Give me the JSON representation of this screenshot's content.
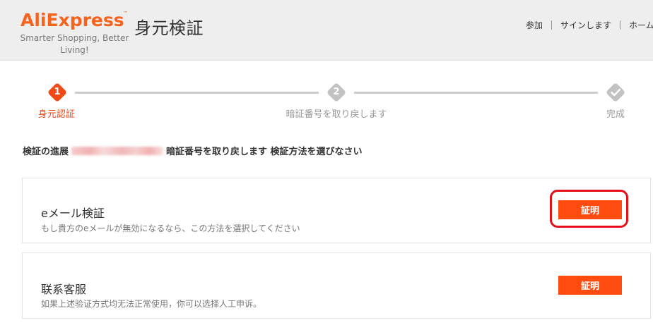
{
  "header": {
    "brand": "AliExpress",
    "tagline": "Smarter Shopping, Better Living!",
    "title": "身元検証",
    "nav": {
      "join": "参加",
      "sign_in": "サインします",
      "home": "ホーム"
    }
  },
  "steps": [
    {
      "number": "1",
      "label": "身元認証",
      "state": "active"
    },
    {
      "number": "2",
      "label": "暗証番号を取り戻します",
      "state": "pending"
    },
    {
      "number": "",
      "label": "完成",
      "state": "pending",
      "icon": "check-icon"
    }
  ],
  "progress": {
    "prefix": "検証の進展",
    "suffix": "暗証番号を取り戻します 検証方法を選びなさい"
  },
  "options": [
    {
      "title": "eメール検証",
      "description": "もし貴方のeメールが無効になるなら、この方法を選択してください",
      "button_label": "証明"
    },
    {
      "title": "联系客服",
      "description": "如果上述验证方式均无法正常使用，你可以选择人工申诉。",
      "button_label": "証明"
    }
  ],
  "colors": {
    "accent": "#ff4b0d",
    "active_step": "#f04b17",
    "inactive_step": "#c2c2c2",
    "highlight": "#e5101a"
  }
}
